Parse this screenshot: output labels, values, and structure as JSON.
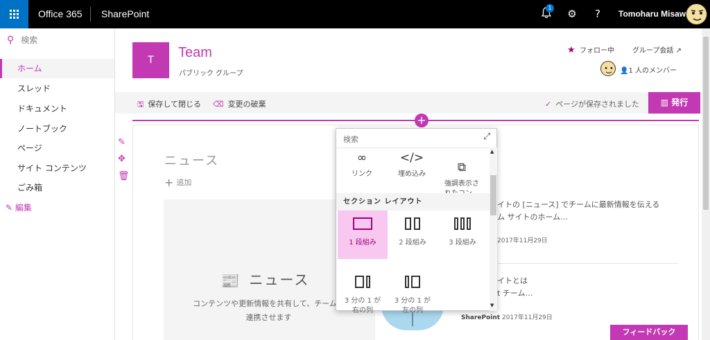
{
  "topbar": {
    "brand": "Office 365",
    "app": "SharePoint",
    "notification_count": "1",
    "username": "Tomoharu Misawa",
    "icons": [
      "app-launcher-icon",
      "bell-icon",
      "gear-icon",
      "help-icon"
    ]
  },
  "nav": {
    "search_placeholder": "検索",
    "items": [
      "ホーム",
      "スレッド",
      "ドキュメント",
      "ノートブック",
      "ページ",
      "サイト コンテンツ",
      "ごみ箱"
    ],
    "edit": "編集"
  },
  "site": {
    "logo_letter": "T",
    "title": "Team",
    "subtitle": "パブリック グループ",
    "following": "フォロー中",
    "group_conversation": "グループ会話",
    "members": "1 人のメンバー"
  },
  "commandbar": {
    "save_close": "保存して閉じる",
    "discard": "変更の破棄",
    "saved_status": "ページが保存されました",
    "publish": "発行"
  },
  "news": {
    "title": "ニュース",
    "add": "追加",
    "placeholder_title": "ニュース",
    "placeholder_desc": "コンテンツや更新情報を共有して、チームを連携させます"
  },
  "right_items": [
    {
      "line1": "イトの [ニュース] でチームに最新情報を伝える",
      "line2": "ム サイトのホーム…",
      "date": "2017年11月29日"
    },
    {
      "line1": "イトとは",
      "line2": "t チーム…",
      "source": "SharePoint",
      "date": "2017年11月29日"
    }
  ],
  "picker": {
    "search": "検索",
    "items": [
      {
        "label": "リンク",
        "icon": "link-icon"
      },
      {
        "label": "埋め込み",
        "icon": "code-icon"
      },
      {
        "label": "強調表示さ\nれたコン…",
        "icon": "highlighted-content-icon"
      }
    ],
    "section_header": "セクション レイアウト",
    "layouts": [
      {
        "label": "1 段組み",
        "selected": true
      },
      {
        "label": "2 段組み",
        "selected": false
      },
      {
        "label": "3 段組み",
        "selected": false
      },
      {
        "label": "3 分の 1 が\n右の列",
        "selected": false
      },
      {
        "label": "3 分の 1 が\n左の列",
        "selected": false
      }
    ]
  },
  "feedback": "フィードバック",
  "colors": {
    "accent": "#c239b3",
    "launcher": "#0072c6",
    "topbar": "#000000"
  }
}
